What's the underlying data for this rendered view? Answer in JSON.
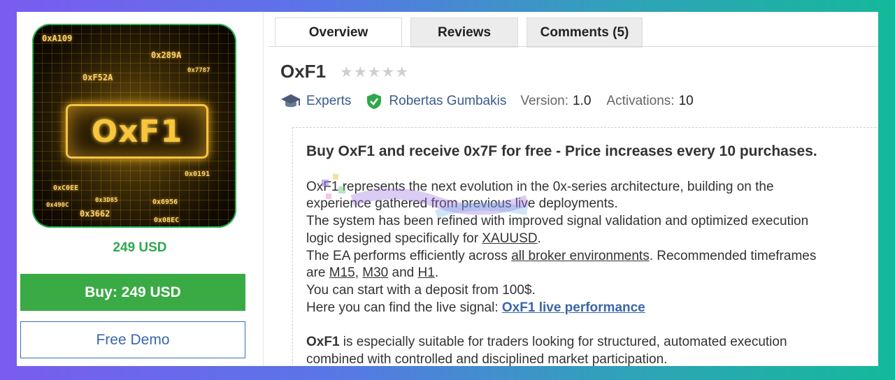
{
  "product": {
    "image_title": "OxF1",
    "hex_labels": [
      "0xA109",
      "0x289A",
      "0xF52A",
      "0x7787",
      "0x0191",
      "0x6956",
      "0x3662",
      "0x08EC",
      "0x490C",
      "0xC0EE",
      "0x3D85"
    ],
    "price": "249 USD",
    "buy_label": "Buy: 249 USD",
    "demo_label": "Free Demo"
  },
  "tabs": [
    {
      "label": "Overview",
      "active": true
    },
    {
      "label": "Reviews",
      "active": false
    },
    {
      "label": "Comments (5)",
      "active": false
    }
  ],
  "header": {
    "title": "OxF1",
    "rating": 0,
    "rating_max": 5,
    "category": "Experts",
    "author": "Robertas Gumbakis",
    "version_label": "Version:",
    "version": "1.0",
    "activations_label": "Activations:",
    "activations": "10"
  },
  "description": {
    "headline": "Buy OxF1 and receive 0x7F for free - Price increases every 10 purchases.",
    "p1_line1": "OxF1 represents the next evolution in the 0x-series architecture, building on the",
    "p1_line2": "experience gathered from previous live deployments.",
    "p2_line1": "The system has been refined with improved signal validation and optimized execution",
    "p2_line2_pre": "logic designed specifically for ",
    "p2_link": "XAUUSD",
    "p2_line2_post": ".",
    "p3_pre": "The EA performs efficiently across ",
    "p3_link": "all broker environments",
    "p3_post": ". Recommended timeframes",
    "p3_line2_pre": "are ",
    "tf1": "M15",
    "tf_sep": ", ",
    "tf2": "M30",
    "tf_and": " and ",
    "tf3": "H1",
    "tf_end": ".",
    "p4": "You can start with a deposit from 100$.",
    "p5_pre": "Here you can find the live signal: ",
    "p5_link": "OxF1 live performance",
    "p6_bold": "OxF1",
    "p6_line1": " is especially suitable for traders looking for structured, automated execution",
    "p6_line2": "combined with controlled and disciplined market participation."
  },
  "colors": {
    "buy_green": "#3aaa44",
    "price_green": "#2fa84f",
    "link_blue": "#3a66a8",
    "verified_green": "#2ea84a"
  },
  "icons": {
    "category": "graduation-cap-icon",
    "author": "verified-shield-icon",
    "rating": "star-icon"
  }
}
